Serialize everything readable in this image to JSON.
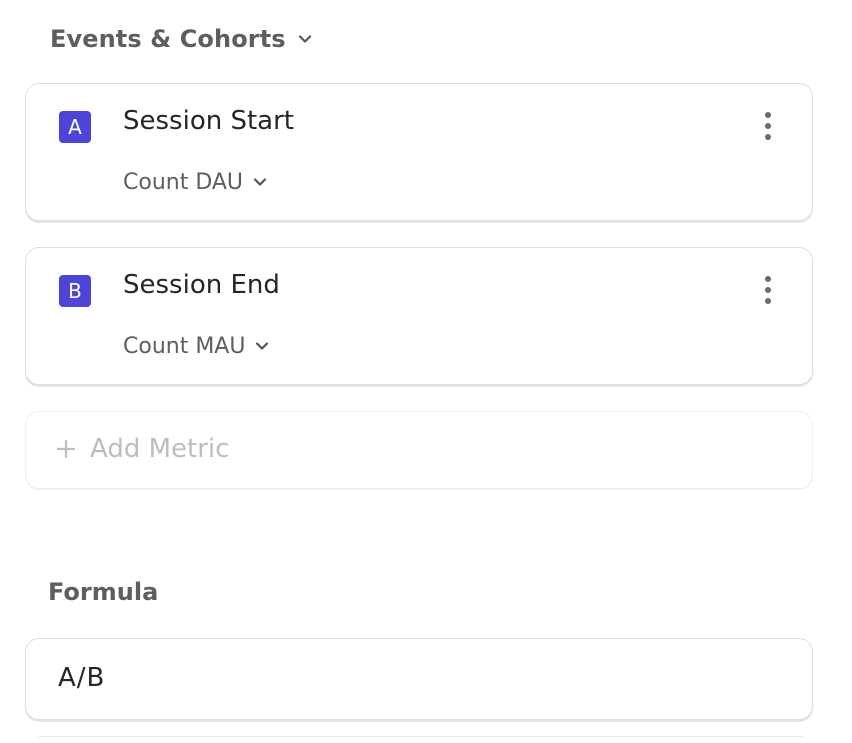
{
  "section": {
    "title": "Events & Cohorts",
    "icon": "chevron-down-icon"
  },
  "metrics": [
    {
      "letter": "A",
      "event": "Session Start",
      "measure": "Count DAU"
    },
    {
      "letter": "B",
      "event": "Session End",
      "measure": "Count MAU"
    }
  ],
  "add_metric": {
    "label": "Add Metric",
    "icon": "plus-icon"
  },
  "formula": {
    "title": "Formula",
    "value": "A/B"
  },
  "colors": {
    "badge": "#4e44d8",
    "muted_text": "#5e5e5e",
    "placeholder_text": "#bdbdbd"
  }
}
